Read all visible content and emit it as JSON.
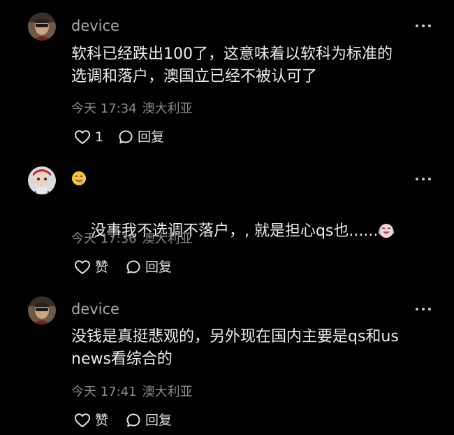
{
  "comments": [
    {
      "username": "device",
      "text": "软科已经跌出100了，这意味着以软科为标准的\n选调和落户，澳国立已经不被认可了",
      "time": "今天 17:34",
      "location": "澳大利亚",
      "like_label": "1",
      "reply_label": "回复"
    },
    {
      "username": "",
      "username_icon": "drooling-face-emoji",
      "text": "没事我不选调不落户，, 就是担心qs也......",
      "trailing_icon": "crying-laughing-emoji",
      "time": "今天 17:36",
      "location": "澳大利亚",
      "like_label": "赞",
      "reply_label": "回复"
    },
    {
      "username": "device",
      "text": "没钱是真挺悲观的，另外现在国内主要是qs和us\nnews看综合的",
      "time": "今天 17:41",
      "location": "澳大利亚",
      "like_label": "赞",
      "reply_label": "回复"
    }
  ]
}
